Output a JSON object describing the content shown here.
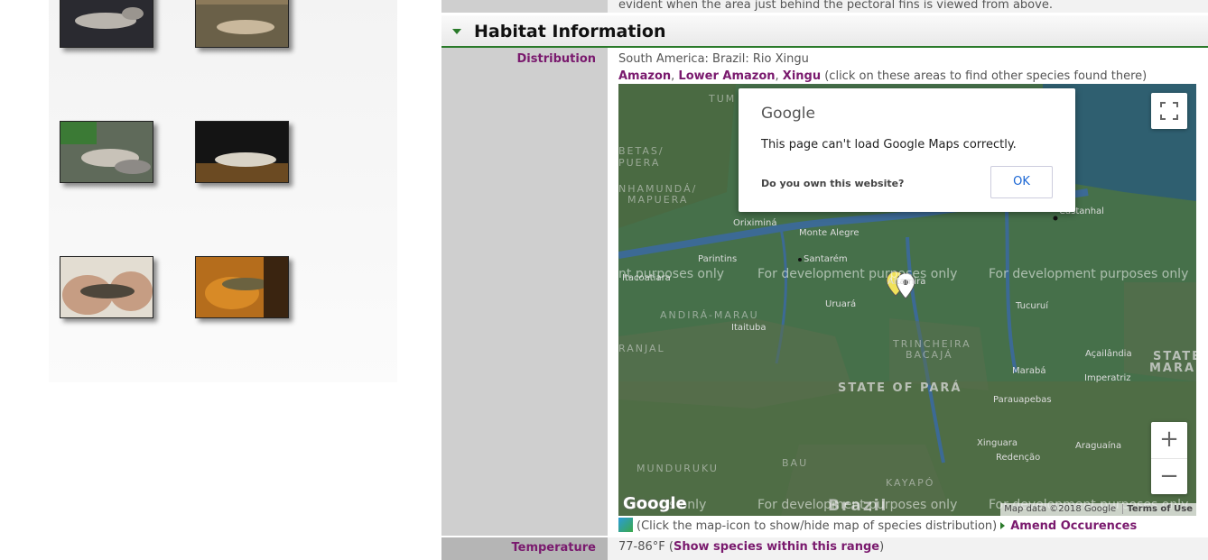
{
  "top_text": "evident when the area just behind the pectoral fins is viewed from above.",
  "section": {
    "title": "Habitat Information"
  },
  "distribution": {
    "label": "Distribution",
    "text": "South America: Brazil: Rio Xingu",
    "areas": [
      "Amazon",
      "Lower Amazon",
      "Xingu"
    ],
    "areas_note": "(click on these areas to find other species found there)"
  },
  "map": {
    "dialog": {
      "logo": "Google",
      "message": "This page can't load Google Maps correctly.",
      "own": "Do you own this website?",
      "ok": "OK"
    },
    "watermarks": [
      "nt purposes only",
      "For development purposes only",
      "For development purposes only",
      "s only",
      "For development purposes only",
      "For development purposes only"
    ],
    "places": [
      "Oriximiná",
      "Monte Alegre",
      "Santarém",
      "Parintins",
      "Itacoatiara",
      "Uruará",
      "Itaituba",
      "Tucuruí",
      "Marabá",
      "Imperatriz",
      "Açailândia",
      "Parauapebas",
      "Xinguara",
      "Araguaína",
      "Redenção",
      "Castanhal",
      "Altamira"
    ],
    "regions": [
      "TUM",
      "BETAS/",
      "PUERA",
      "NHAMUNDÁ/",
      "MAPUERA",
      "ANDIRÁ-MARAU",
      "RANJAL",
      "TRINCHEIRA",
      "BACAJÁ",
      "MUNDURUKU",
      "BAU",
      "KAYAPÓ"
    ],
    "states": [
      "STATE OF PARÁ",
      "STATE",
      "MARAN"
    ],
    "country": "Brazil",
    "google_logo": "Google",
    "attribution": "Map data ©2018 Google",
    "terms": "Terms of Use",
    "zoom_in": "+",
    "zoom_out": "−"
  },
  "map_note": "(Click the map-icon to show/hide map of species distribution)",
  "amend": "Amend Occurences",
  "temperature": {
    "label": "Temperature",
    "value": "77-86°F (",
    "link": "Show species within this range",
    "close": ")"
  }
}
